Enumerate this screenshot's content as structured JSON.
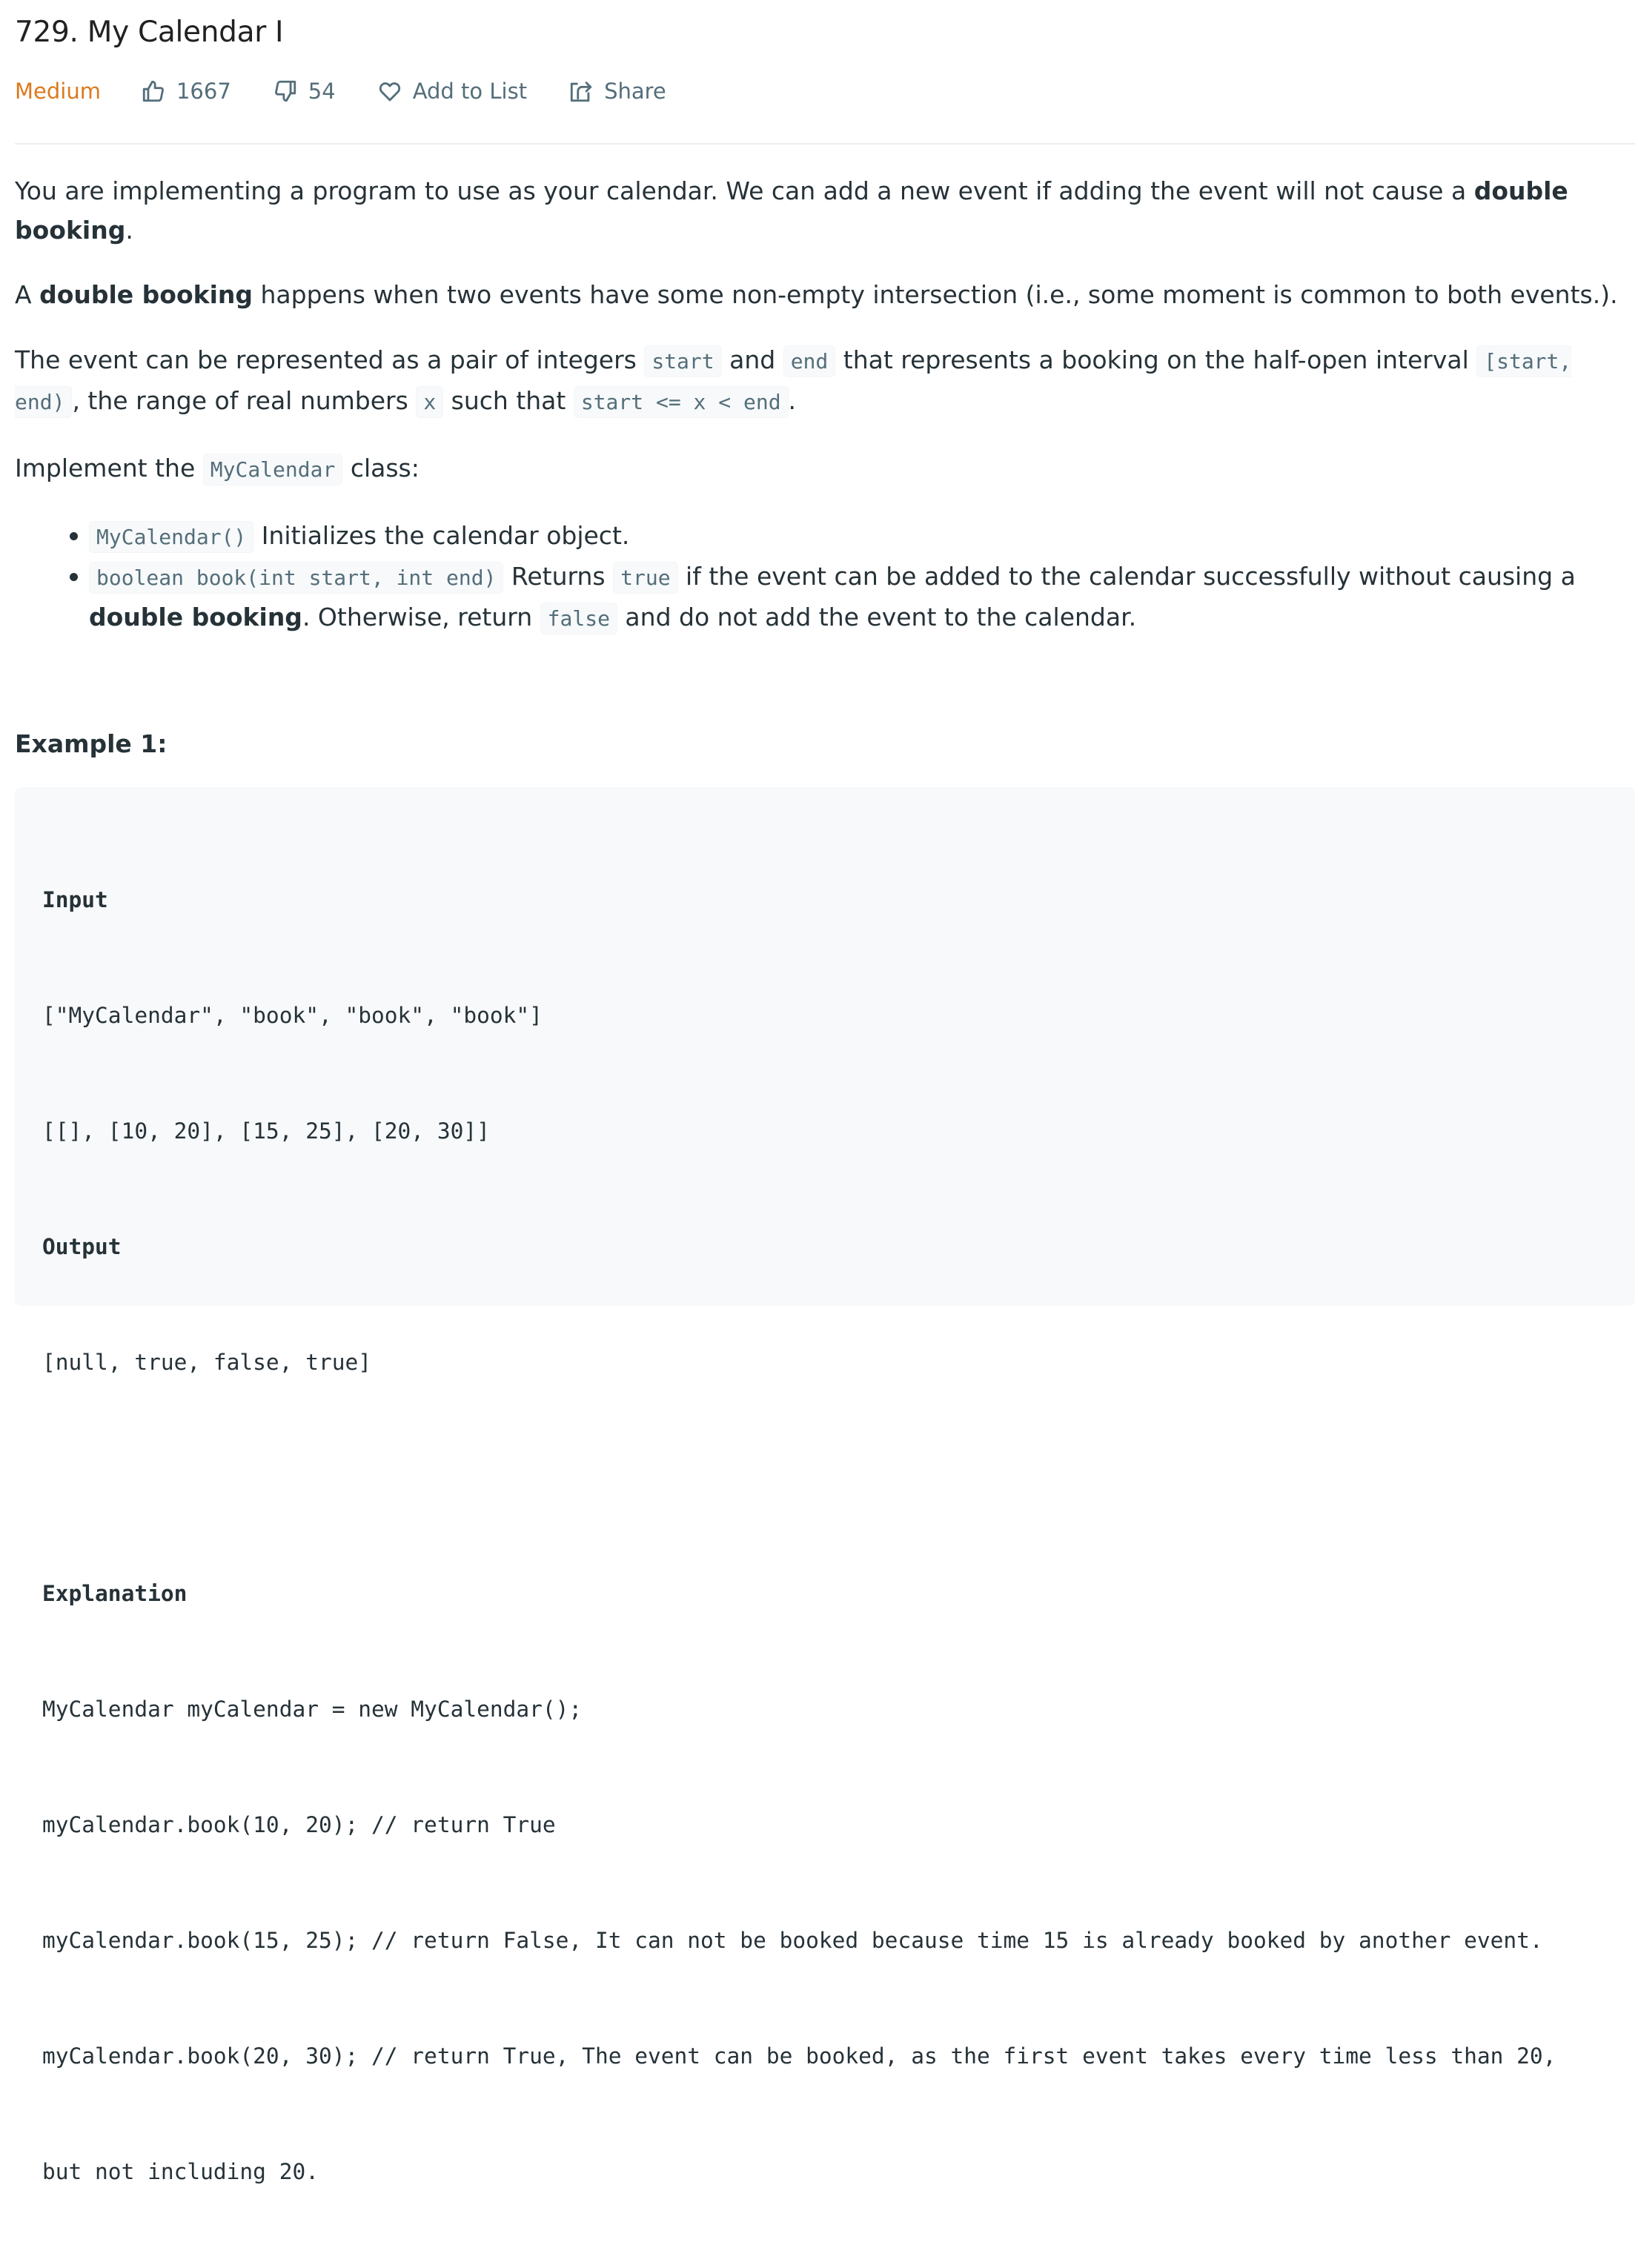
{
  "problem": {
    "title": "729. My Calendar I",
    "difficulty": "Medium",
    "difficulty_color": "#dc7a1e",
    "likes": "1667",
    "dislikes": "54",
    "add_to_list_label": "Add to List",
    "share_label": "Share",
    "icons": {
      "like": "thumbs-up-icon",
      "dislike": "thumbs-down-icon",
      "add_to_list": "heart-icon",
      "share": "share-icon"
    }
  },
  "description": {
    "p1": {
      "text": "You are implementing a program to use as your calendar. We can add a new event if adding the event will not cause a ",
      "bold": "double booking",
      "tail": "."
    },
    "p2": {
      "lead": "A ",
      "bold": "double booking",
      "text": " happens when two events have some non-empty intersection (i.e., some moment is common to both events.)."
    },
    "p3": {
      "t1": "The event can be represented as a pair of integers ",
      "c1": "start",
      "t2": " and ",
      "c2": "end",
      "t3": " that represents a booking on the half-open interval ",
      "c3": "[start, end)",
      "t4": ", the range of real numbers ",
      "c4": "x",
      "t5": " such that ",
      "c5": "start <= x < end",
      "t6": "."
    },
    "p4": {
      "t1": "Implement the ",
      "c1": "MyCalendar",
      "t2": " class:"
    },
    "bullets": [
      {
        "code": "MyCalendar()",
        "text": " Initializes the calendar object."
      },
      {
        "code": "boolean book(int start, int end)",
        "t1": " Returns ",
        "c2": "true",
        "t2": " if the event can be added to the calendar successfully without causing a ",
        "bold": "double booking",
        "t3": ". Otherwise, return ",
        "c3": "false",
        "t4": " and do not add the event to the calendar."
      }
    ]
  },
  "example": {
    "title": "Example 1:",
    "lines": [
      {
        "text": "Input",
        "bold": true
      },
      {
        "text": "[\"MyCalendar\", \"book\", \"book\", \"book\"]",
        "bold": false
      },
      {
        "text": "[[], [10, 20], [15, 25], [20, 30]]",
        "bold": false
      },
      {
        "text": "Output",
        "bold": true
      },
      {
        "text": "[null, true, false, true]",
        "bold": false
      },
      {
        "text": "",
        "bold": false
      },
      {
        "text": "Explanation",
        "bold": true
      },
      {
        "text": "MyCalendar myCalendar = new MyCalendar();",
        "bold": false
      },
      {
        "text": "myCalendar.book(10, 20); // return True",
        "bold": false
      },
      {
        "text": "myCalendar.book(15, 25); // return False, It can not be booked because time 15 is already booked by another event.",
        "bold": false
      },
      {
        "text": "myCalendar.book(20, 30); // return True, The event can be booked, as the first event takes every time less than 20,",
        "bold": false
      },
      {
        "text": "but not including 20.",
        "bold": false
      }
    ]
  }
}
